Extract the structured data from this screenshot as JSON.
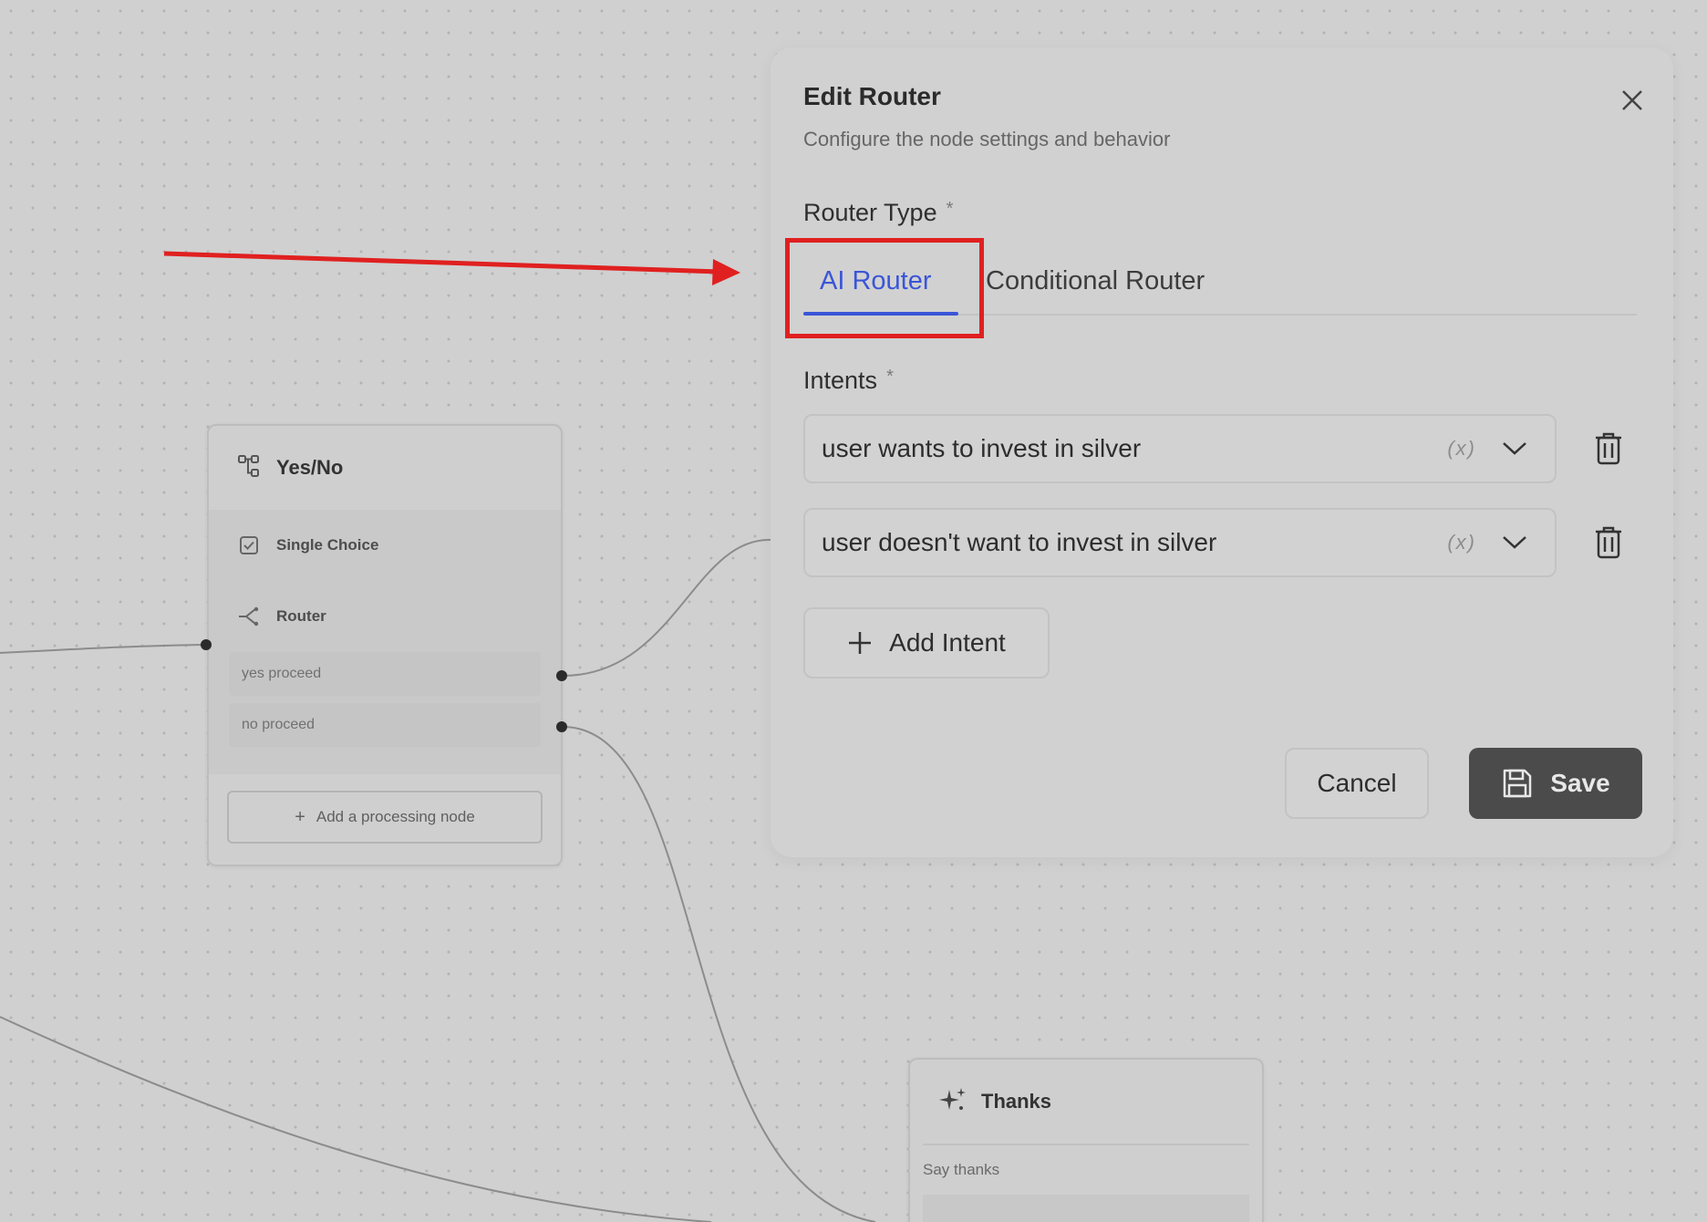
{
  "canvas": {
    "yesno_node": {
      "title": "Yes/No",
      "icon": "branch-icon",
      "rows": [
        {
          "icon": "checkbox-icon",
          "label": "Single Choice"
        },
        {
          "icon": "router-icon",
          "label": "Router"
        }
      ],
      "routes": [
        "yes proceed",
        "no proceed"
      ],
      "add_button_label": "Add a processing node"
    },
    "thanks_node": {
      "title": "Thanks",
      "icon": "sparkle-icon",
      "subtitle": "Say thanks"
    }
  },
  "modal": {
    "title": "Edit Router",
    "subtitle": "Configure the node settings and behavior",
    "router_type_label": "Router Type",
    "required_mark": "*",
    "tabs": [
      {
        "label": "AI Router",
        "active": true
      },
      {
        "label": "Conditional Router",
        "active": false
      }
    ],
    "intents_label": "Intents",
    "intents": [
      {
        "value": "user wants to invest in silver",
        "badge": "(x)"
      },
      {
        "value": "user doesn't want to invest in silver",
        "badge": "(x)"
      }
    ],
    "add_intent_label": "Add Intent",
    "cancel_label": "Cancel",
    "save_label": "Save"
  },
  "colors": {
    "accent": "#3a55d8",
    "annotation": "#e02020",
    "save_bg": "#4b4b4b"
  }
}
